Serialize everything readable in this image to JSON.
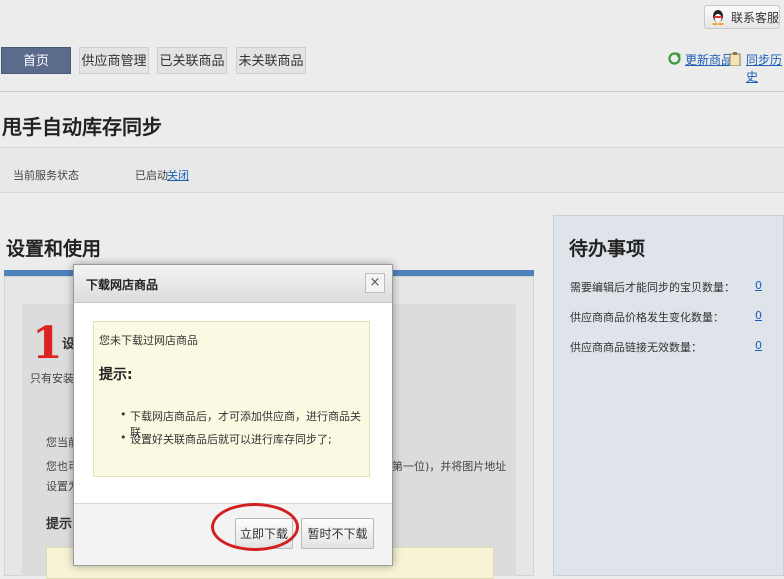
{
  "header": {
    "contact_label": "联系客服"
  },
  "nav": {
    "tabs": [
      {
        "label": "首页",
        "active": true
      },
      {
        "label": "供应商管理",
        "active": false
      },
      {
        "label": "已关联商品",
        "active": false
      },
      {
        "label": "未关联商品",
        "active": false
      }
    ],
    "update_link": "更新商品",
    "history_link": "同步历史"
  },
  "page": {
    "title": "甩手自动库存同步",
    "service_status_label": "当前服务状态",
    "service_status_value": "已启动",
    "service_close_link": "关闭"
  },
  "setup": {
    "title": "设置和使用",
    "step_number": "1",
    "step_title_partial": "设",
    "text_partial_1": "只有安装了",
    "text_partial_2": "您当前",
    "text_partial_3": "您也可",
    "text_partial_4": "第一位)，并将图片地址",
    "text_partial_5": "设置为",
    "tip_partial": "提示:"
  },
  "todo": {
    "title": "待办事项",
    "items": [
      {
        "label": "需要编辑后才能同步的宝贝数量：",
        "value": "0"
      },
      {
        "label": "供应商商品价格发生变化数量：",
        "value": "0"
      },
      {
        "label": "供应商商品链接无效数量：",
        "value": "0"
      }
    ]
  },
  "modal": {
    "title": "下载网店商品",
    "close": "×",
    "message": "您未下载过网店商品",
    "tip_heading": "提示:",
    "bullets": [
      "下载网店商品后，才可添加供应商，进行商品关联",
      "设置好关联商品后就可以进行库存同步了;"
    ],
    "primary_button": "立即下载",
    "secondary_button": "暂时不下载"
  },
  "colors": {
    "active_tab": "#5b6b8c",
    "link": "#1a5fb4",
    "accent_bar": "#4f81bd",
    "highlight": "#d31f1f",
    "step_number": "#dd2222"
  }
}
